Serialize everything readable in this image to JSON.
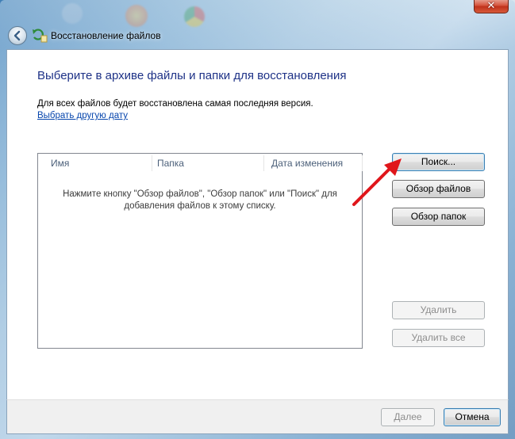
{
  "window": {
    "title": "Восстановление файлов",
    "close_glyph": "✕"
  },
  "content": {
    "heading": "Выберите в архиве файлы и папки для восстановления",
    "subtext": "Для всех файлов будет восстановлена самая последняя версия.",
    "link": "Выбрать другую дату"
  },
  "list": {
    "columns": [
      "Имя",
      "Папка",
      "Дата изменения"
    ],
    "empty_message_line1": "Нажмите кнопку \"Обзор файлов\", \"Обзор папок\" или \"Поиск\" для",
    "empty_message_line2": "добавления файлов к этому списку."
  },
  "side_buttons": {
    "search": "Поиск...",
    "browse_files": "Обзор файлов",
    "browse_folders": "Обзор папок",
    "delete": "Удалить",
    "delete_all": "Удалить все"
  },
  "footer": {
    "next": "Далее",
    "cancel": "Отмена"
  },
  "colors": {
    "heading": "#1e3287",
    "link": "#0645ad",
    "annotation_arrow": "#e0161b"
  }
}
